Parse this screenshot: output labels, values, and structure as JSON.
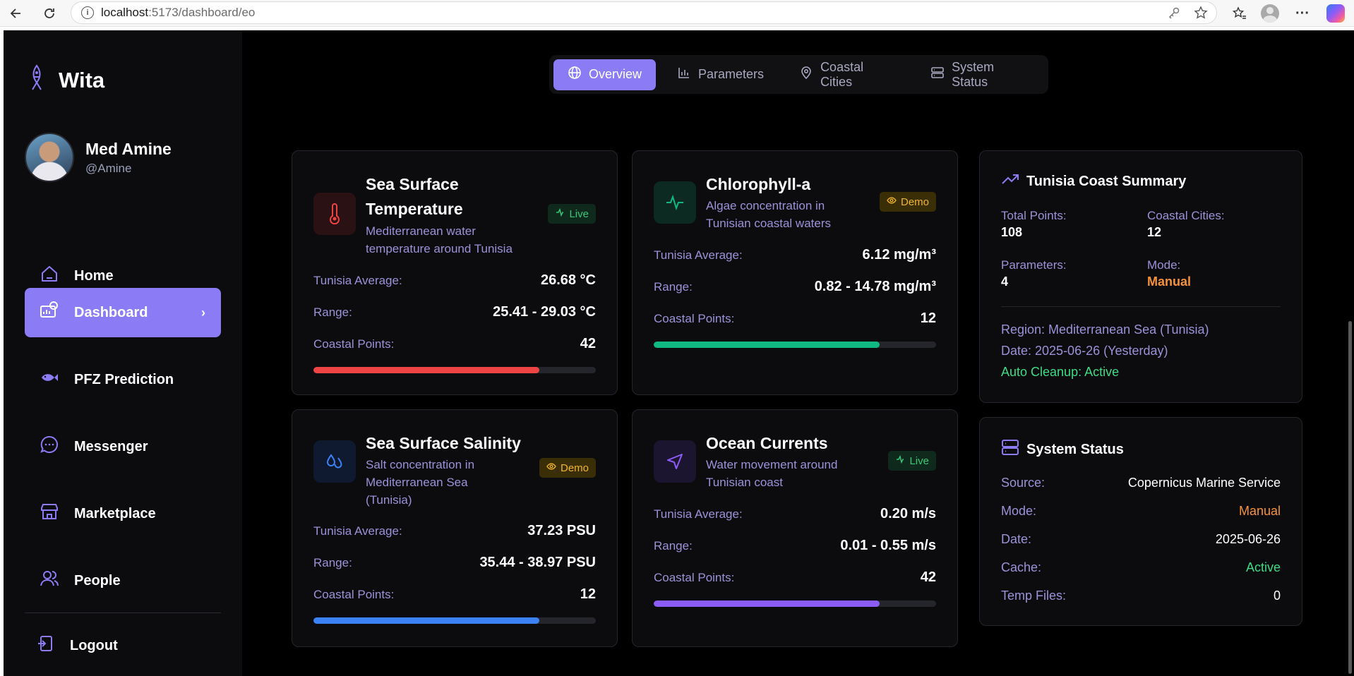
{
  "browser": {
    "url_host": "localhost",
    "url_path": ":5173/dashboard/eo"
  },
  "sidebar": {
    "brand": "Wita",
    "user_name": "Med Amine",
    "user_handle": "@Amine",
    "items": [
      {
        "label": "Home",
        "icon": "home-icon"
      },
      {
        "label": "Dashboard",
        "icon": "dashboard-icon"
      },
      {
        "label": "PFZ Prediction",
        "icon": "fish-icon"
      },
      {
        "label": "Messenger",
        "icon": "chat-icon"
      },
      {
        "label": "Marketplace",
        "icon": "store-icon"
      },
      {
        "label": "People",
        "icon": "people-icon"
      }
    ],
    "logout": "Logout"
  },
  "tabs": [
    {
      "label": "Overview",
      "icon": "globe-icon",
      "active": true
    },
    {
      "label": "Parameters",
      "icon": "bar-chart-icon"
    },
    {
      "label": "Coastal Cities",
      "icon": "map-pin-icon"
    },
    {
      "label": "System Status",
      "icon": "server-icon"
    }
  ],
  "cards": {
    "sst": {
      "title_line1": "Sea Surface",
      "title_line2": "Temperature",
      "desc_line1": "Mediterranean water",
      "desc_line2": "temperature around Tunisia",
      "badge": "Live",
      "avg_label": "Tunisia Average:",
      "avg": "26.68 °C",
      "range_label": "Range:",
      "range": "25.41 - 29.03 °C",
      "points_label": "Coastal Points:",
      "points": "42",
      "progress": 0.8,
      "color": "#ef4444"
    },
    "chl": {
      "title": "Chlorophyll-a",
      "desc_line1": "Algae concentration in",
      "desc_line2": "Tunisian coastal waters",
      "badge": "Demo",
      "avg_label": "Tunisia Average:",
      "avg": "6.12 mg/m³",
      "range_label": "Range:",
      "range": "0.82 - 14.78 mg/m³",
      "points_label": "Coastal Points:",
      "points": "12",
      "progress": 0.8,
      "color": "#10b981"
    },
    "sss": {
      "title": "Sea Surface Salinity",
      "desc_line1": "Salt concentration in",
      "desc_line2": "Mediterranean Sea",
      "desc_line3": "(Tunisia)",
      "badge": "Demo",
      "avg_label": "Tunisia Average:",
      "avg": "37.23 PSU",
      "range_label": "Range:",
      "range": "35.44 - 38.97 PSU",
      "points_label": "Coastal Points:",
      "points": "12",
      "progress": 0.8,
      "color": "#3b82f6"
    },
    "cur": {
      "title": "Ocean Currents",
      "desc_line1": "Water movement around",
      "desc_line2": "Tunisian coast",
      "badge": "Live",
      "avg_label": "Tunisia Average:",
      "avg": "0.20 m/s",
      "range_label": "Range:",
      "range": "0.01 - 0.55 m/s",
      "points_label": "Coastal Points:",
      "points": "42",
      "progress": 0.8,
      "color": "#8b5cf6"
    }
  },
  "summary": {
    "title": "Tunisia Coast Summary",
    "total_points_label": "Total Points:",
    "total_points": "108",
    "coastal_cities_label": "Coastal Cities:",
    "coastal_cities": "12",
    "parameters_label": "Parameters:",
    "parameters": "4",
    "mode_label": "Mode:",
    "mode": "Manual",
    "region": "Region: Mediterranean Sea (Tunisia)",
    "date": "Date: 2025-06-26 (Yesterday)",
    "cleanup": "Auto Cleanup: Active"
  },
  "status": {
    "title": "System Status",
    "rows": [
      {
        "k": "Source:",
        "v": "Copernicus Marine Service"
      },
      {
        "k": "Mode:",
        "v": "Manual"
      },
      {
        "k": "Date:",
        "v": "2025-06-26"
      },
      {
        "k": "Cache:",
        "v": "Active"
      },
      {
        "k": "Temp Files:",
        "v": "0"
      }
    ]
  }
}
